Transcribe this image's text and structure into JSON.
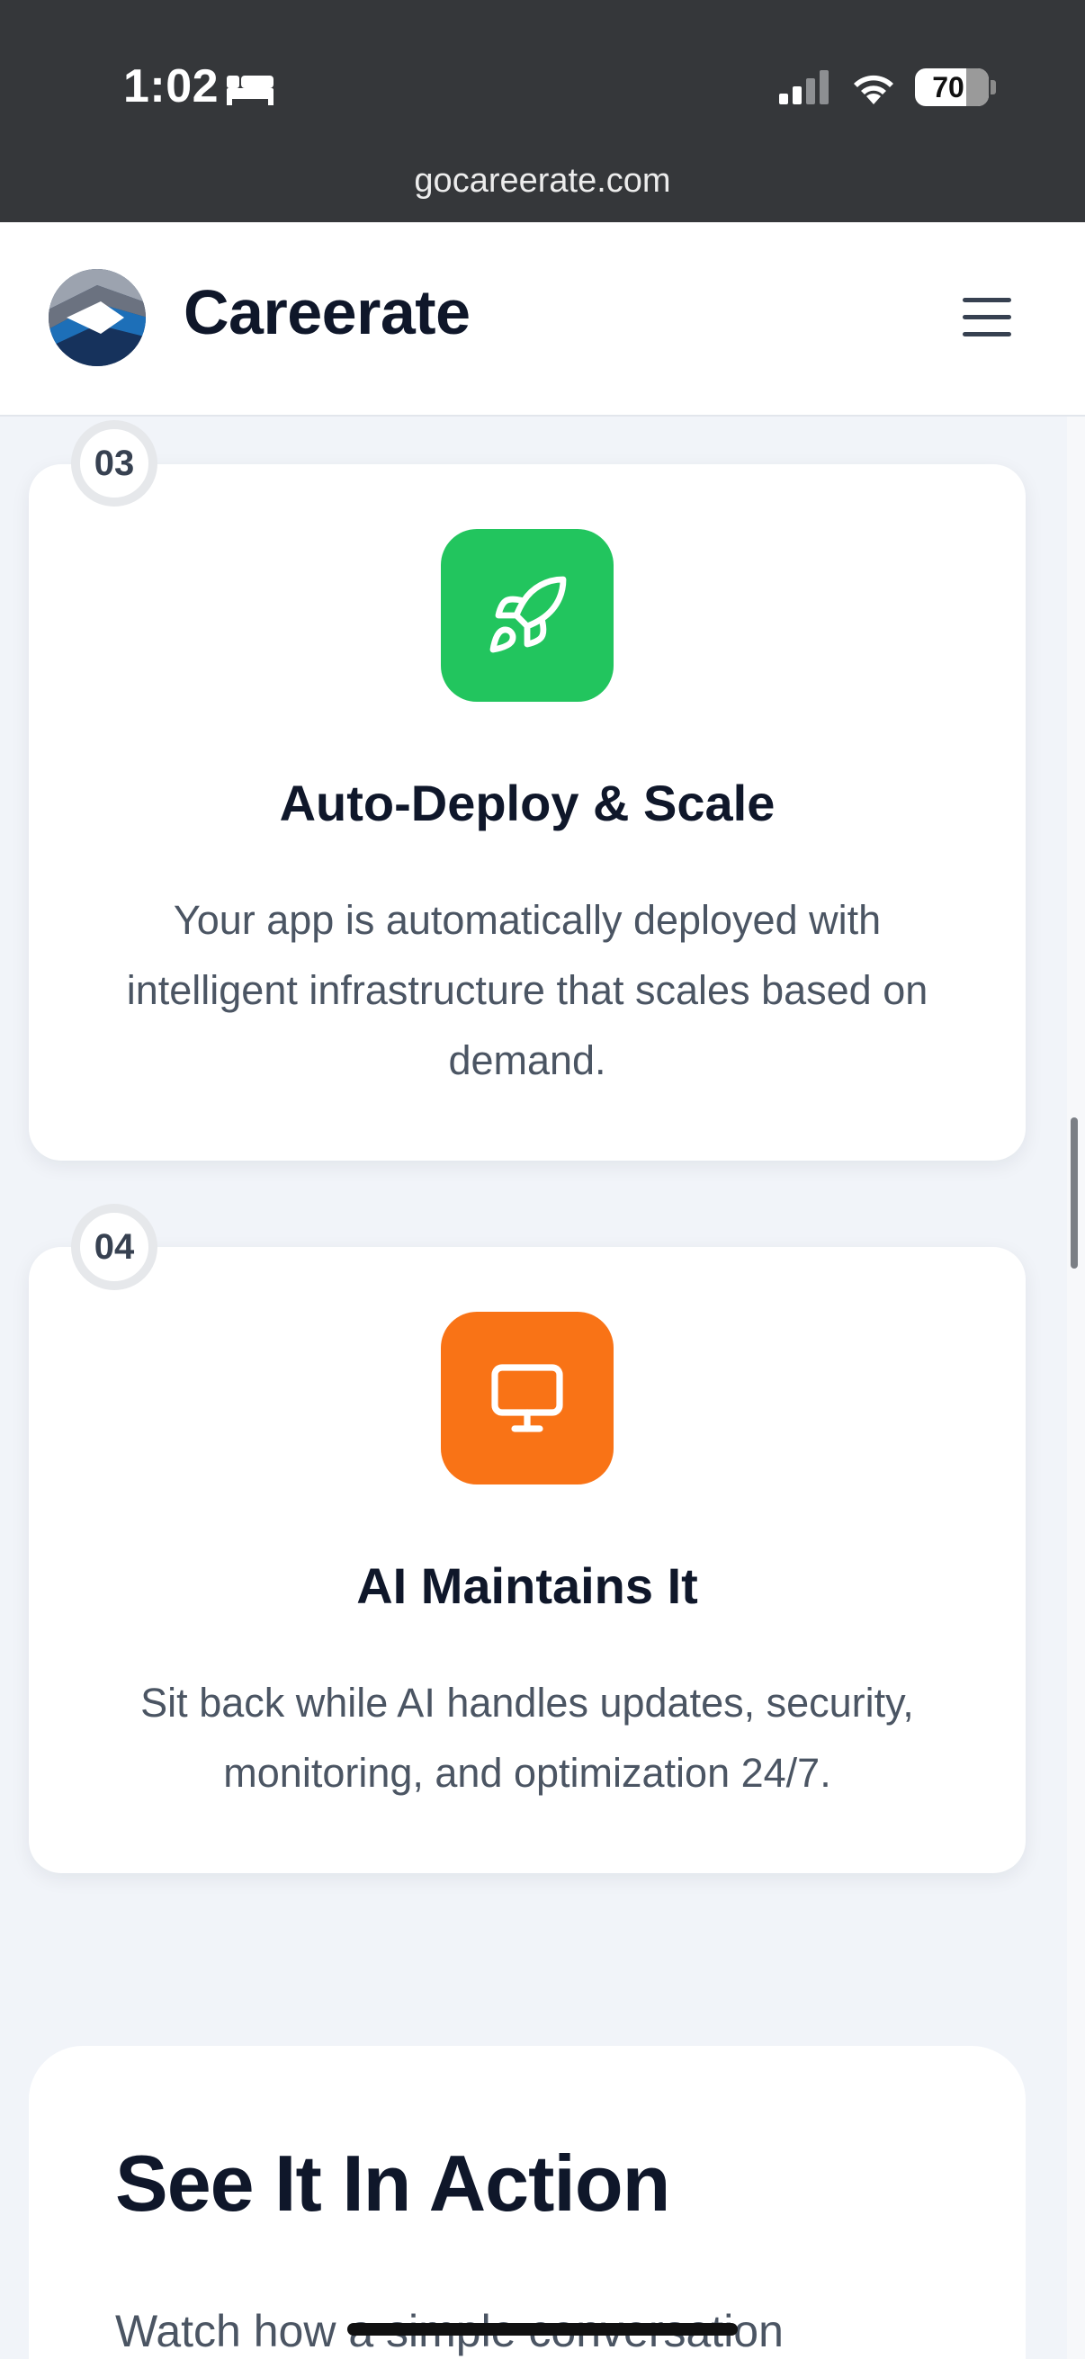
{
  "status_bar": {
    "time": "1:02",
    "battery": "70",
    "url": "gocareerate.com"
  },
  "header": {
    "brand": "Careerate"
  },
  "steps": [
    {
      "number": "03",
      "title": "Auto-Deploy & Scale",
      "description": "Your app is automatically deployed with intelligent infrastructure that scales based on demand.",
      "icon": "rocket-icon",
      "color": "#22c55e"
    },
    {
      "number": "04",
      "title": "AI Maintains It",
      "description": "Sit back while AI handles updates, security, monitoring, and optimization 24/7.",
      "icon": "monitor-icon",
      "color": "#f97316"
    }
  ],
  "action": {
    "title": "See It In Action",
    "subtitle": "Watch how a simple conversation"
  }
}
